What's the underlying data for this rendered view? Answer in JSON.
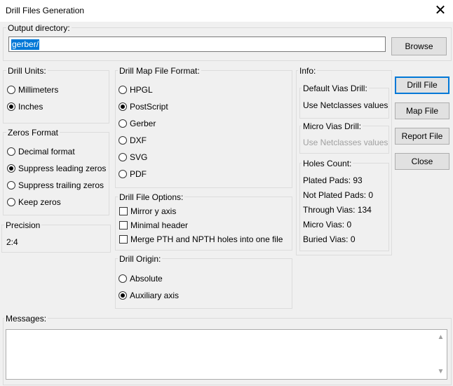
{
  "window": {
    "title": "Drill Files Generation"
  },
  "output_directory": {
    "label": "Output directory:",
    "value": "gerber/",
    "browse_label": "Browse"
  },
  "drill_units": {
    "label": "Drill Units:",
    "options": [
      "Millimeters",
      "Inches"
    ],
    "selected": "Inches"
  },
  "zeros_format": {
    "label": "Zeros Format",
    "options": [
      "Decimal format",
      "Suppress leading zeros",
      "Suppress trailing zeros",
      "Keep zeros"
    ],
    "selected": "Suppress leading zeros"
  },
  "precision": {
    "label": "Precision",
    "value": "2:4"
  },
  "drill_map_format": {
    "label": "Drill Map File Format:",
    "options": [
      "HPGL",
      "PostScript",
      "Gerber",
      "DXF",
      "SVG",
      "PDF"
    ],
    "selected": "PostScript"
  },
  "drill_file_options": {
    "label": "Drill File Options:",
    "items": [
      {
        "label": "Mirror y axis",
        "checked": false
      },
      {
        "label": "Minimal header",
        "checked": false
      },
      {
        "label": "Merge PTH and NPTH holes into one file",
        "checked": false
      }
    ]
  },
  "drill_origin": {
    "label": "Drill Origin:",
    "options": [
      "Absolute",
      "Auxiliary axis"
    ],
    "selected": "Auxiliary axis"
  },
  "info": {
    "label": "Info:",
    "default_vias": {
      "label": "Default Vias Drill:",
      "value": "Use Netclasses values"
    },
    "micro_vias": {
      "label": "Micro Vias Drill:",
      "value": "Use Netclasses values"
    },
    "holes_count": {
      "label": "Holes Count:",
      "lines": [
        "Plated Pads: 93",
        "Not Plated Pads: 0",
        "Through Vias: 134",
        "Micro Vias: 0",
        "Buried Vias: 0"
      ]
    }
  },
  "buttons": {
    "drill_file": "Drill File",
    "map_file": "Map File",
    "report_file": "Report File",
    "close": "Close"
  },
  "messages": {
    "label": "Messages:"
  },
  "icons": {
    "close": "close-icon",
    "scroll_up": "chevron-up-icon",
    "scroll_down": "chevron-down-icon"
  },
  "colors": {
    "accent": "#0078d7"
  }
}
